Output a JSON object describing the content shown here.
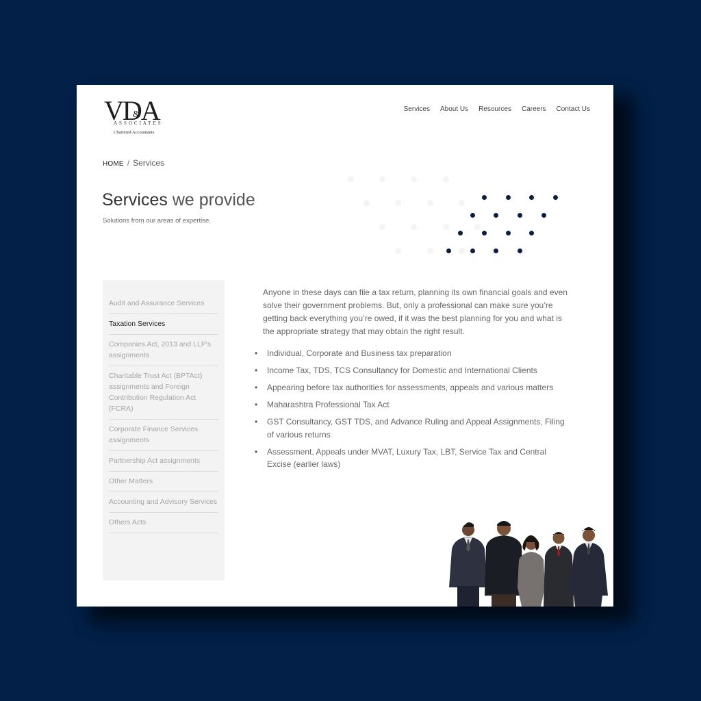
{
  "brand": {
    "logo_main": "VDA",
    "logo_amp": "&",
    "logo_sub": "ASSOCIATES",
    "logo_tagline": "Chartered Accountants"
  },
  "nav": {
    "items": [
      "Services",
      "About Us",
      "Resources",
      "Careers",
      "Contact Us"
    ]
  },
  "breadcrumb": {
    "home": "HOME",
    "separator": "/",
    "current": "Services"
  },
  "header": {
    "title_bold": "Services",
    "title_light": "we provide",
    "subtitle": "Solutions from our areas of expertise."
  },
  "sidebar": {
    "items": [
      {
        "label": "Audit and Assurance Services",
        "active": false
      },
      {
        "label": "Taxation Services",
        "active": true
      },
      {
        "label": "Companies Act, 2013 and LLP's assignments",
        "active": false
      },
      {
        "label": "Charitable Trust Act (BPTAct) assignments and Foreign Contribution Regulation Act (FCRA)",
        "active": false
      },
      {
        "label": "Corporate Finance Services assignments",
        "active": false
      },
      {
        "label": "Partnership Act assignments",
        "active": false
      },
      {
        "label": "Other Matters",
        "active": false
      },
      {
        "label": "Accounting and Advisory Services",
        "active": false
      },
      {
        "label": "Others Acts",
        "active": false
      }
    ]
  },
  "content": {
    "intro": "Anyone in these days can file a tax return, planning its own financial goals and even solve their government problems. But, only a professional can make sure you’re getting back everything you’re owed, if it was the best planning for you and what is the appropriate strategy that may obtain the right result.",
    "bullet_glyph": "•",
    "bullets": [
      "Individual, Corporate and Business tax preparation",
      "Income Tax, TDS, TCS Consultancy for Domestic and International Clients",
      "Appearing before tax authorities for assessments, appeals and various matters",
      "Maharashtra Professional Tax Act",
      "GST Consultancy, GST TDS, and Advance Ruling and Appeal Assignments, Filing of various returns",
      "Assessment, Appeals under MVAT, Luxury Tax, LBT, Service Tax and Central Excise (earlier laws)"
    ]
  },
  "team_photo": {
    "description": "team-photo",
    "people_count": 5
  },
  "colors": {
    "background": "#022048",
    "accent_dots": "#0c1e45",
    "sidebar_bg": "#f3f3f3"
  }
}
